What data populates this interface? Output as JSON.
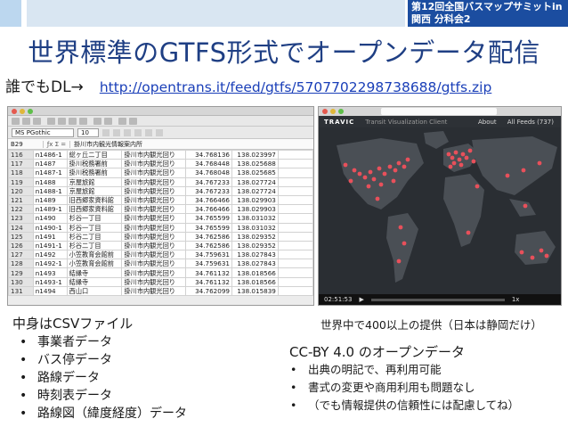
{
  "banner": {
    "label": "第12回全国バスマップサミットin関西 分科会2",
    "colors": {
      "dark": "#1b4da0",
      "light": "#bcd7ef",
      "stripe": "#d9e6f2"
    }
  },
  "slide": {
    "title": "世界標準のGTFS形式でオープンデータ配信",
    "dl_prefix": "誰でもDL→",
    "dl_link": "http://opentrans.it/feed/gtfs/5707702298738688/gtfs.zip"
  },
  "spreadsheet": {
    "font_name": "MS PGothic",
    "font_size": "10",
    "cell_ref": "B29",
    "formula_value": "掛川市内観光情報案内所",
    "rows": [
      {
        "n": "116",
        "c1": "n1486-1",
        "c2": "総ヶ丘二丁目",
        "c3": "掛川市内観光回り",
        "c4": "34.768136",
        "c5": "138.023997",
        "c6": ""
      },
      {
        "n": "117",
        "c1": "n1487",
        "c2": "掛川税務署前",
        "c3": "掛川市内観光回り",
        "c4": "34.768448",
        "c5": "138.025688",
        "c6": ""
      },
      {
        "n": "118",
        "c1": "n1487-1",
        "c2": "掛川税務署前",
        "c3": "掛川市内観光回り",
        "c4": "34.768048",
        "c5": "138.025685",
        "c6": ""
      },
      {
        "n": "119",
        "c1": "n1488",
        "c2": "京屋旅館",
        "c3": "掛川市内観光回り",
        "c4": "34.767233",
        "c5": "138.027724",
        "c6": ""
      },
      {
        "n": "120",
        "c1": "n1488-1",
        "c2": "京屋旅館",
        "c3": "掛川市内観光回り",
        "c4": "34.767233",
        "c5": "138.027724",
        "c6": ""
      },
      {
        "n": "121",
        "c1": "n1489",
        "c2": "旧西郷家資料館",
        "c3": "掛川市内観光回り",
        "c4": "34.766466",
        "c5": "138.029903",
        "c6": ""
      },
      {
        "n": "122",
        "c1": "n1489-1",
        "c2": "旧西郷家資料館",
        "c3": "掛川市内観光回り",
        "c4": "34.766466",
        "c5": "138.029903",
        "c6": ""
      },
      {
        "n": "123",
        "c1": "n1490",
        "c2": "杉谷一丁目",
        "c3": "掛川市内観光回り",
        "c4": "34.765599",
        "c5": "138.031032",
        "c6": ""
      },
      {
        "n": "124",
        "c1": "n1490-1",
        "c2": "杉谷一丁目",
        "c3": "掛川市内観光回り",
        "c4": "34.765599",
        "c5": "138.031032",
        "c6": ""
      },
      {
        "n": "125",
        "c1": "n1491",
        "c2": "杉谷二丁目",
        "c3": "掛川市内観光回り",
        "c4": "34.762586",
        "c5": "138.029352",
        "c6": ""
      },
      {
        "n": "126",
        "c1": "n1491-1",
        "c2": "杉谷二丁目",
        "c3": "掛川市内観光回り",
        "c4": "34.762586",
        "c5": "138.029352",
        "c6": ""
      },
      {
        "n": "127",
        "c1": "n1492",
        "c2": "小笠教育会館前",
        "c3": "掛川市内観光回り",
        "c4": "34.759631",
        "c5": "138.027843",
        "c6": ""
      },
      {
        "n": "128",
        "c1": "n1492-1",
        "c2": "小笠教育会館前",
        "c3": "掛川市内観光回り",
        "c4": "34.759631",
        "c5": "138.027843",
        "c6": ""
      },
      {
        "n": "129",
        "c1": "n1493",
        "c2": "結縁寺",
        "c3": "掛川市内観光回り",
        "c4": "34.761132",
        "c5": "138.018566",
        "c6": ""
      },
      {
        "n": "130",
        "c1": "n1493-1",
        "c2": "結縁寺",
        "c3": "掛川市内観光回り",
        "c4": "34.761132",
        "c5": "138.018566",
        "c6": ""
      },
      {
        "n": "131",
        "c1": "n1494",
        "c2": "西山口",
        "c3": "掛川市内観光回り",
        "c4": "34.762099",
        "c5": "138.015839",
        "c6": ""
      }
    ]
  },
  "map": {
    "brand": "TRAVIC",
    "subtitle": "Transit Visualization Client",
    "nav": [
      "About",
      "All Feeds (737)"
    ],
    "time": "02:51:53",
    "speed": "1x"
  },
  "content": {
    "left_heading": "中身はCSVファイル",
    "left_items": [
      "事業者データ",
      "バス停データ",
      "路線データ",
      "時刻表データ",
      "路線図（緯度経度）データ"
    ],
    "right_heading": "世界中で400以上の提供（日本は静岡だけ）",
    "cc_heading": "CC-BY 4.0 のオープンデータ",
    "right_items": [
      "出典の明記で、再利用可能",
      "書式の変更や商用利用も問題なし",
      "（でも情報提供の信頼性には配慮してね）"
    ]
  }
}
